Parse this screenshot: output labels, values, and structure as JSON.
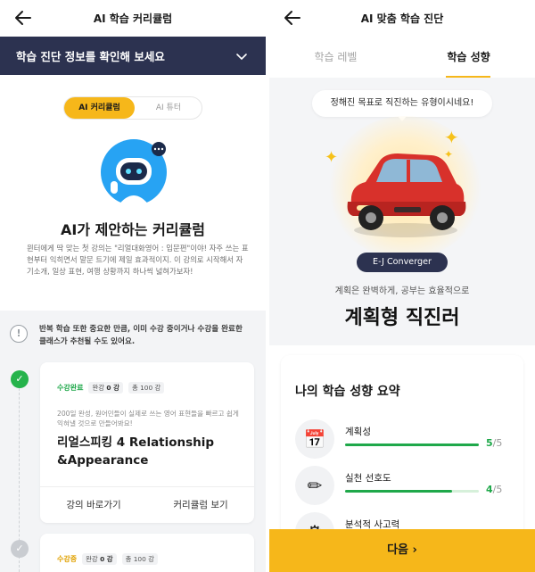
{
  "left": {
    "header_title": "AI 학습 커리큘럼",
    "banner_text": "학습 진단 정보를 확인해 보세요",
    "segment": {
      "option_1": "AI 커리큘럼",
      "option_2": "AI 튜터"
    },
    "intro_title": "AI가 제안하는 커리큘럼",
    "intro_desc": "윈터에게 딱 맞는 첫 강의는 \"리얼대화영어 : 입문편\"이야! 자주 쓰는 표현부터 익히면서 말문 트기에 제일 효과적이지. 이 강의로 시작해서 자기소개, 일상 표현, 여행 상황까지 하나씩 넓혀가보자!",
    "notice": "반복 학습 또한 중요한 만큼, 이미 수강 중이거나 수강을 완료한 클래스가 추천될 수도 있어요.",
    "courses": [
      {
        "status": "수강완료",
        "done_label": "완강",
        "done_count": "0 강",
        "total": "총 100 강",
        "desc": "200일 완성, 원어민들이 실제로 쓰는 영어 표현들을 빠르고 쉽게 익혀낼 것으로 만들어봐요!",
        "title": "리얼스피킹 4 Relationship &Appearance",
        "action_1": "강의 바로가기",
        "action_2": "커리큘럼 보기"
      },
      {
        "status": "수강중",
        "done_label": "완강",
        "done_count": "0 강",
        "total": "총 100 강"
      }
    ],
    "check_glyph": "✓"
  },
  "right": {
    "header_title": "AI 맞춤 학습 진단",
    "tabs": [
      "학습 레벨",
      "학습 성향"
    ],
    "bubble": "정해진 목표로 직진하는 유형이시네요!",
    "type_code": "E-J Converger",
    "type_sub": "계획은 완벽하게, 공부는 효율적으로",
    "type_title": "계획형 직진러",
    "summary_title": "나의 학습 성향 요약",
    "metrics": [
      {
        "name": "계획성",
        "score": "5",
        "max": "/5",
        "fraction": 1.0,
        "icon": "calendar-icon",
        "glyph": "📅"
      },
      {
        "name": "실천 선호도",
        "score": "4",
        "max": "/5",
        "fraction": 0.8,
        "icon": "pencil-icon",
        "glyph": "✏"
      },
      {
        "name": "분석적 사고력",
        "score": "",
        "max": "",
        "fraction": 0,
        "icon": "gear-icon",
        "glyph": "⚙"
      }
    ],
    "next_button": "다음 ›"
  },
  "colors": {
    "accent": "#f6b71a",
    "navy": "#2c3250",
    "success": "#1fa84a"
  }
}
